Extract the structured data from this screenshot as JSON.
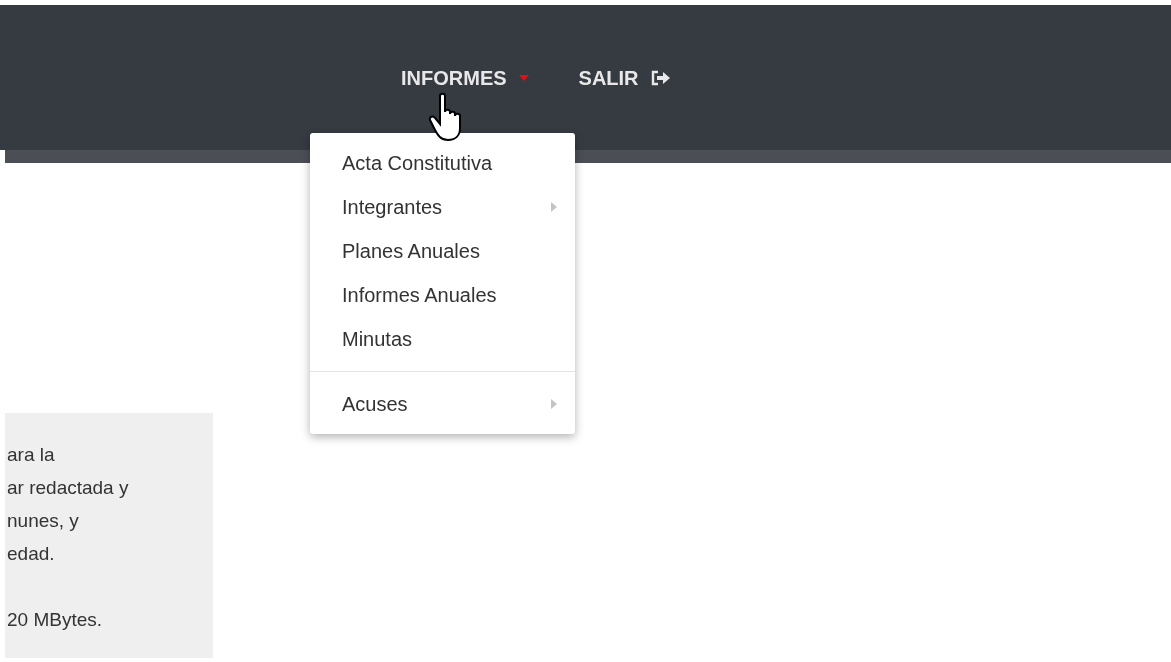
{
  "nav": {
    "items": [
      {
        "label": "INFORMES",
        "kind": "dropdown",
        "expanded": true
      },
      {
        "label": "SALIR",
        "kind": "logout"
      }
    ]
  },
  "dropdown_menu": {
    "items": [
      {
        "label": "Acta Constitutiva",
        "kind": "item"
      },
      {
        "label": "Integrantes",
        "kind": "submenu"
      },
      {
        "label": "Planes Anuales",
        "kind": "item"
      },
      {
        "label": "Informes Anuales",
        "kind": "item"
      },
      {
        "label": "Minutas",
        "kind": "item"
      },
      {
        "kind": "divider"
      },
      {
        "label": "Acuses",
        "kind": "submenu"
      }
    ]
  },
  "info_panel": {
    "paragraphs": [
      [
        "ara la",
        "ar redactada y",
        "nunes, y",
        "edad."
      ],
      [
        "20 MBytes."
      ]
    ]
  }
}
